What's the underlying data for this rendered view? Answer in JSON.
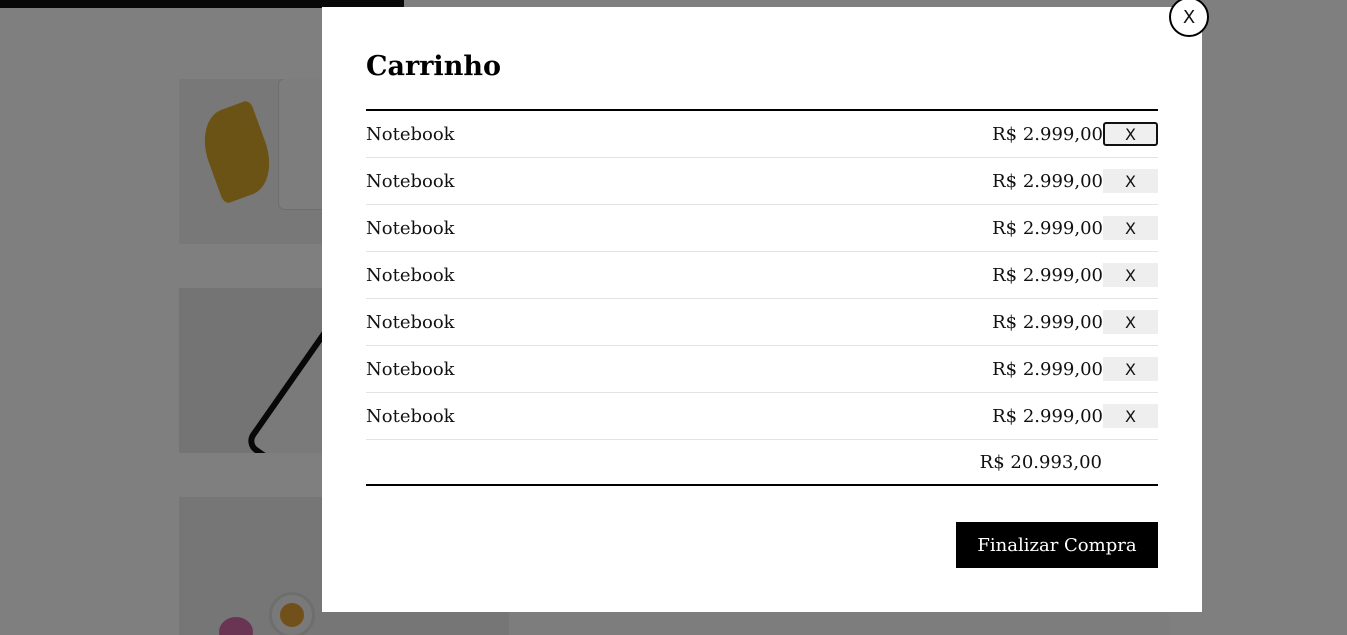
{
  "modal": {
    "close_label": "X",
    "title": "Carrinho",
    "items": [
      {
        "name": "Notebook",
        "price": "R$ 2.999,00",
        "remove_label": "X"
      },
      {
        "name": "Notebook",
        "price": "R$ 2.999,00",
        "remove_label": "X"
      },
      {
        "name": "Notebook",
        "price": "R$ 2.999,00",
        "remove_label": "X"
      },
      {
        "name": "Notebook",
        "price": "R$ 2.999,00",
        "remove_label": "X"
      },
      {
        "name": "Notebook",
        "price": "R$ 2.999,00",
        "remove_label": "X"
      },
      {
        "name": "Notebook",
        "price": "R$ 2.999,00",
        "remove_label": "X"
      },
      {
        "name": "Notebook",
        "price": "R$ 2.999,00",
        "remove_label": "X"
      }
    ],
    "total": "R$ 20.993,00",
    "checkout_label": "Finalizar Compra"
  }
}
